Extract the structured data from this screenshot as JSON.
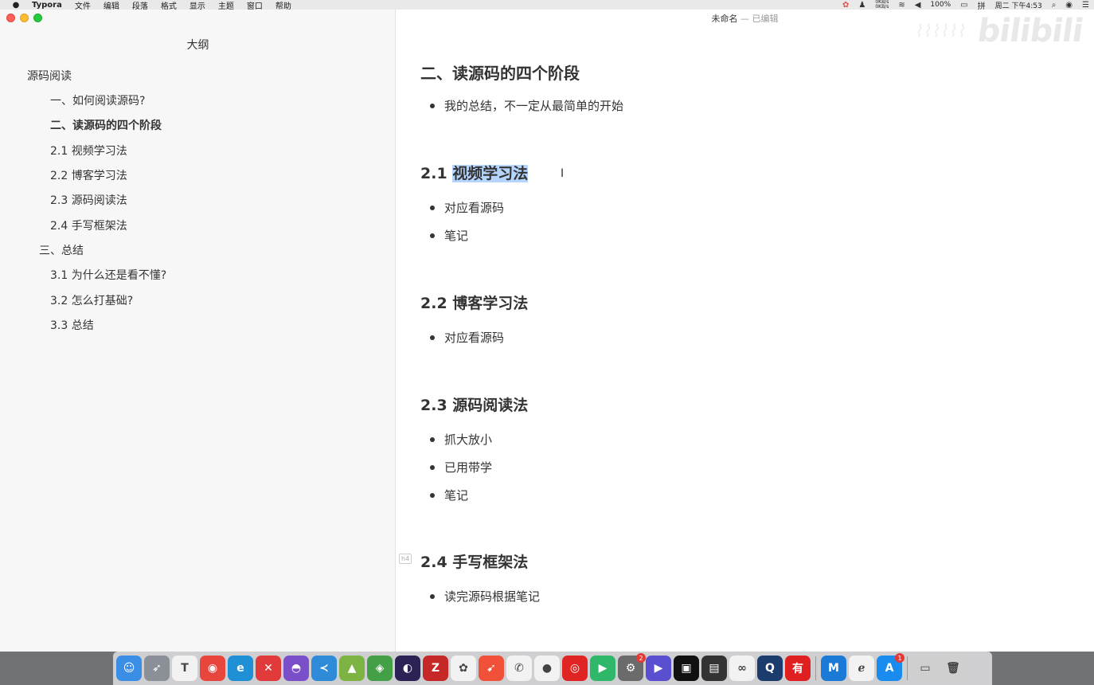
{
  "menubar": {
    "app_name": "Typora",
    "menus": [
      "文件",
      "编辑",
      "段落",
      "格式",
      "显示",
      "主题",
      "窗口",
      "帮助"
    ],
    "battery": "100%",
    "input_method": "拼",
    "clock": "周二 下午4:53",
    "net_up": "0KB/s",
    "net_down": "0KB/s"
  },
  "window": {
    "title": "未命名",
    "edited_suffix": " — 已编辑"
  },
  "sidebar": {
    "title": "大纲",
    "items": [
      {
        "label": "源码阅读",
        "level": 1,
        "bold": false
      },
      {
        "label": "一、如何阅读源码?",
        "level": 3,
        "bold": false
      },
      {
        "label": "二、读源码的四个阶段",
        "level": 3,
        "bold": true
      },
      {
        "label": "2.1 视频学习法",
        "level": 3,
        "bold": false
      },
      {
        "label": "2.2 博客学习法",
        "level": 3,
        "bold": false
      },
      {
        "label": "2.3 源码阅读法",
        "level": 3,
        "bold": false
      },
      {
        "label": "2.4 手写框架法",
        "level": 3,
        "bold": false
      },
      {
        "label": "三、总结",
        "level": 2,
        "bold": false
      },
      {
        "label": "3.1 为什么还是看不懂?",
        "level": 3,
        "bold": false
      },
      {
        "label": "3.2 怎么打基础?",
        "level": 3,
        "bold": false
      },
      {
        "label": "3.3 总结",
        "level": 3,
        "bold": false
      }
    ]
  },
  "document": {
    "h2": "二、读源码的四个阶段",
    "h2_bullet": "我的总结，不一定从最简单的开始",
    "s21": {
      "prefix": "2.1 ",
      "selected": "视频学习法",
      "bullets": [
        "对应看源码",
        "笔记"
      ]
    },
    "s22": {
      "title": "2.2 博客学习法",
      "bullets": [
        "对应看源码"
      ]
    },
    "s23": {
      "title": "2.3 源码阅读法",
      "bullets": [
        "抓大放小",
        "已用带学",
        "笔记"
      ]
    },
    "s24": {
      "title": "2.4 手写框架法",
      "marker": "h4",
      "bullets": [
        "读完源码根据笔记"
      ]
    }
  },
  "watermark": {
    "logo": "bilibili"
  },
  "dock": {
    "icons": [
      {
        "name": "finder",
        "color": "#3a8ee6",
        "glyph": "☺"
      },
      {
        "name": "launchpad",
        "color": "#8a8f98",
        "glyph": "➶"
      },
      {
        "name": "typora",
        "color": "#f2f2f2",
        "glyph": "T"
      },
      {
        "name": "chrome",
        "color": "#e8453c",
        "glyph": "◉"
      },
      {
        "name": "edge-beta",
        "color": "#1f8fd6",
        "glyph": "e"
      },
      {
        "name": "xmind",
        "color": "#e03a3a",
        "glyph": "✕"
      },
      {
        "name": "github",
        "color": "#7b4fc9",
        "glyph": "◓"
      },
      {
        "name": "vscode",
        "color": "#2f8ad8",
        "glyph": "≺"
      },
      {
        "name": "android-studio",
        "color": "#7cb342",
        "glyph": "▲"
      },
      {
        "name": "android-tool",
        "color": "#43a047",
        "glyph": "◈"
      },
      {
        "name": "eclipse",
        "color": "#2c2255",
        "glyph": "◐"
      },
      {
        "name": "filezilla",
        "color": "#c62828",
        "glyph": "Z"
      },
      {
        "name": "photos",
        "color": "#f2f2f2",
        "glyph": "✿"
      },
      {
        "name": "swift",
        "color": "#f05138",
        "glyph": "➹"
      },
      {
        "name": "wechat",
        "color": "#f2f2f2",
        "glyph": "✆"
      },
      {
        "name": "qq",
        "color": "#f2f2f2",
        "glyph": "●"
      },
      {
        "name": "netease-music",
        "color": "#e02424",
        "glyph": "◎"
      },
      {
        "name": "video-player",
        "color": "#30b86a",
        "glyph": "▶"
      },
      {
        "name": "system-preferences",
        "color": "#6b6b6b",
        "glyph": "⚙",
        "badge": "2"
      },
      {
        "name": "final-cut",
        "color": "#5a4fd0",
        "glyph": "▶"
      },
      {
        "name": "screen-tool",
        "color": "#111111",
        "glyph": "▣"
      },
      {
        "name": "clapper",
        "color": "#333333",
        "glyph": "▤"
      },
      {
        "name": "link-app",
        "color": "#f2f2f2",
        "glyph": "∞"
      },
      {
        "name": "quicktime",
        "color": "#1d3c6e",
        "glyph": "Q"
      },
      {
        "name": "youdao",
        "color": "#e02020",
        "glyph": "有"
      },
      {
        "name": "mweb",
        "color": "#1b7ad6",
        "glyph": "M"
      },
      {
        "name": "eudic",
        "color": "#f2f2f2",
        "glyph": "ℯ"
      },
      {
        "name": "app-store",
        "color": "#1a8cf0",
        "glyph": "A",
        "badge": "1"
      },
      {
        "name": "downloads-stack",
        "color": "#cfcfcf",
        "glyph": "▭"
      },
      {
        "name": "trash",
        "color": "#cfcfcf",
        "glyph": "🗑"
      }
    ]
  }
}
